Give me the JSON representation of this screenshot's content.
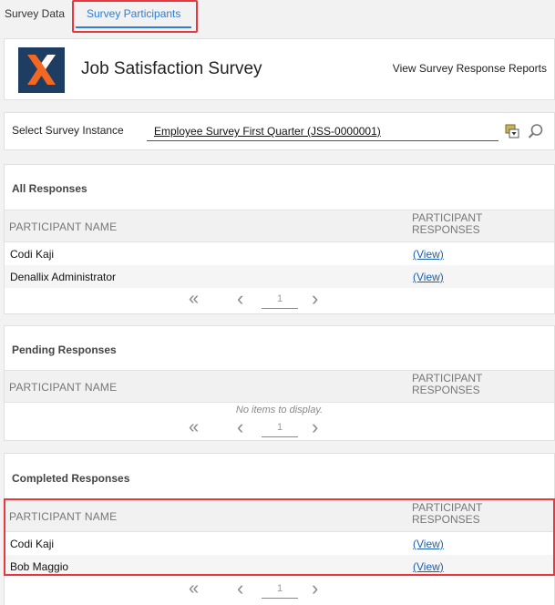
{
  "tabs": [
    {
      "label": "Survey Data"
    },
    {
      "label": "Survey Participants"
    }
  ],
  "header": {
    "title": "Job Satisfaction Survey",
    "link": "View Survey Response Reports"
  },
  "instance": {
    "label": "Select Survey Instance",
    "value": "Employee Survey First Quarter (JSS-0000001)"
  },
  "columns": {
    "name": "PARTICIPANT NAME",
    "responses_line1": "PARTICIPANT",
    "responses_line2": "RESPONSES"
  },
  "sections": {
    "all": {
      "title": "All Responses",
      "rows": [
        {
          "name": "Codi Kaji",
          "action": "(View)"
        },
        {
          "name": "Denallix Administrator",
          "action": "(View)"
        }
      ],
      "page": "1"
    },
    "pending": {
      "title": "Pending Responses",
      "empty": "No items to display.",
      "page": "1"
    },
    "completed": {
      "title": "Completed Responses",
      "rows": [
        {
          "name": "Codi Kaji",
          "action": "(View)"
        },
        {
          "name": "Bob Maggio",
          "action": "(View)"
        }
      ],
      "page": "1"
    }
  },
  "pager": {
    "first": "«",
    "prev": "‹",
    "next": "›"
  },
  "colors": {
    "accent": "#2b7fd8",
    "highlight": "#e5393f",
    "logo_bg": "#1e3d63",
    "logo_mark": "#f26722"
  }
}
